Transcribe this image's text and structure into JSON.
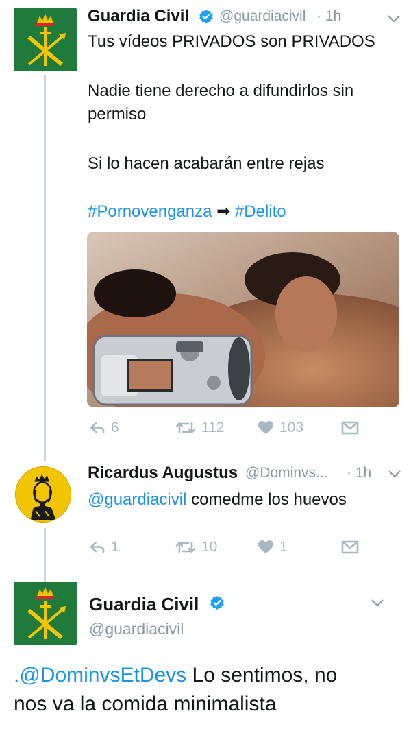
{
  "tweet1": {
    "name": "Guardia Civil",
    "handle": "@guardiacivil",
    "time": "· 1h",
    "line1": "Tus vídeos PRIVADOS son PRIVADOS",
    "line2a": "Nadie tiene derecho a difundirlos sin",
    "line2b": "permiso",
    "line3": "Si lo hacen acabarán entre rejas",
    "hashtag1": "#Pornovenganza",
    "arrow": "➡",
    "hashtag2": "#Delito",
    "replies": "6",
    "retweets": "112",
    "likes": "103"
  },
  "tweet2": {
    "name": "Ricardus Augustus",
    "handle": "@Dominvs...",
    "time": "· 1h",
    "mention": "@guardiacivil",
    "text": " comedme los huevos",
    "replies": "1",
    "retweets": "10",
    "likes": "1"
  },
  "tweet3": {
    "name": "Guardia Civil",
    "handle": "@guardiacivil",
    "mention": ".@DominvsEtDevs",
    "text_a": " Lo sentimos, no",
    "text_b": "nos va la comida minimalista"
  },
  "icons": {
    "reply": "reply-icon",
    "retweet": "retweet-icon",
    "like": "heart-icon",
    "dm": "envelope-icon",
    "verified": "verified-badge-icon",
    "chevron": "chevron-down-icon"
  },
  "colors": {
    "link": "#1b95e0",
    "muted": "#8899a6",
    "actions": "#aab8c2",
    "avatar_green": "#1f7a3c",
    "thread_line": "#ccd6dd"
  }
}
